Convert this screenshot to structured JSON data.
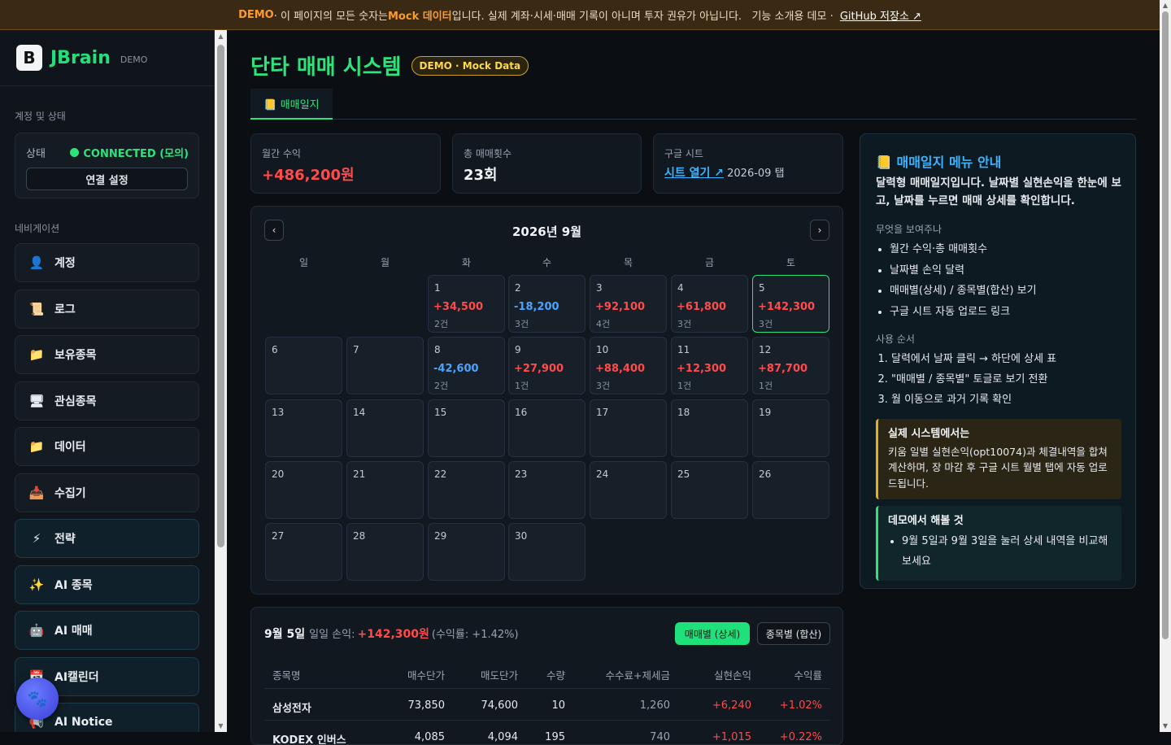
{
  "banner": {
    "demo": "DEMO",
    "pre": " · 이 페이지의 모든 숫자는 ",
    "mock": "Mock 데이터",
    "post": "입니다. 실제 계좌·시세·매매 기록이 아니며 투자 권유가 아닙니다.   기능 소개용 데모 · ",
    "link": "GitHub 저장소 ↗"
  },
  "sidebar": {
    "brand": {
      "logo": "B",
      "name": "JBrain",
      "tag": "DEMO"
    },
    "account_section": "계정 및 상태",
    "status_label": "상태",
    "status_value": "CONNECTED (모의)",
    "connect_button": "연결 설정",
    "nav_section": "네비게이션",
    "items": [
      {
        "label": "계정",
        "icon": "👤"
      },
      {
        "label": "로그",
        "icon": "📜"
      },
      {
        "label": "보유종목",
        "icon": "📁"
      },
      {
        "label": "관심종목",
        "icon": "🖥"
      },
      {
        "label": "데이터",
        "icon": "📁"
      },
      {
        "label": "수집기",
        "icon": "📥"
      },
      {
        "label": "전략",
        "icon": "⚡"
      },
      {
        "label": "AI 종목",
        "icon": "✨"
      },
      {
        "label": "AI 매매",
        "icon": "🤖"
      },
      {
        "label": "AI캘린더",
        "icon": "📅"
      },
      {
        "label": "AI Notice",
        "icon": "📢"
      }
    ],
    "fab_icon": "🐾"
  },
  "header": {
    "title": "단타 매매 시스템",
    "badge": "DEMO · Mock Data",
    "tab": "📒 매매일지"
  },
  "kpis": {
    "month_label": "월간 수익",
    "month_value": "+486,200원",
    "count_label": "총 매매횟수",
    "count_value": "23회",
    "sheet_label": "구글 시트",
    "sheet_link": "시트 열기 ↗",
    "sheet_tab": " 2026-09 탭"
  },
  "calendar": {
    "title": "2026년 9월",
    "prev": "‹",
    "next": "›",
    "weekdays": [
      "일",
      "월",
      "화",
      "수",
      "목",
      "금",
      "토"
    ],
    "selected_day": 5,
    "days": [
      {
        "d": "1",
        "pnl": "+34,500",
        "cnt": "2건",
        "sign": "pos"
      },
      {
        "d": "2",
        "pnl": "-18,200",
        "cnt": "3건",
        "sign": "neg"
      },
      {
        "d": "3",
        "pnl": "+92,100",
        "cnt": "4건",
        "sign": "pos"
      },
      {
        "d": "4",
        "pnl": "+61,800",
        "cnt": "3건",
        "sign": "pos"
      },
      {
        "d": "5",
        "pnl": "+142,300",
        "cnt": "3건",
        "sign": "pos"
      },
      {
        "d": "6"
      },
      {
        "d": "7"
      },
      {
        "d": "8",
        "pnl": "-42,600",
        "cnt": "2건",
        "sign": "neg"
      },
      {
        "d": "9",
        "pnl": "+27,900",
        "cnt": "1건",
        "sign": "pos"
      },
      {
        "d": "10",
        "pnl": "+88,400",
        "cnt": "3건",
        "sign": "pos"
      },
      {
        "d": "11",
        "pnl": "+12,300",
        "cnt": "1건",
        "sign": "pos"
      },
      {
        "d": "12",
        "pnl": "+87,700",
        "cnt": "1건",
        "sign": "pos"
      },
      {
        "d": "13"
      },
      {
        "d": "14"
      },
      {
        "d": "15"
      },
      {
        "d": "16"
      },
      {
        "d": "17"
      },
      {
        "d": "18"
      },
      {
        "d": "19"
      },
      {
        "d": "20"
      },
      {
        "d": "21"
      },
      {
        "d": "22"
      },
      {
        "d": "23"
      },
      {
        "d": "24"
      },
      {
        "d": "25"
      },
      {
        "d": "26"
      },
      {
        "d": "27"
      },
      {
        "d": "28"
      },
      {
        "d": "29"
      },
      {
        "d": "30"
      }
    ]
  },
  "detail": {
    "date": "9월 5일",
    "label": "일일 손익:",
    "amount": "+142,300원",
    "rate": "(수익률: +1.42%)",
    "toggle_on": "매매별 (상세)",
    "toggle_off": "종목별 (합산)",
    "columns": [
      "종목명",
      "매수단가",
      "매도단가",
      "수량",
      "수수료+제세금",
      "실현손익",
      "수익률"
    ],
    "rows": [
      [
        "삼성전자",
        "73,850",
        "74,600",
        "10",
        "1,260",
        "+6,240",
        "+1.02%"
      ],
      [
        "KODEX 인버스",
        "4,085",
        "4,094",
        "195",
        "740",
        "+1,015",
        "+0.22%"
      ]
    ]
  },
  "guide": {
    "title": "📒 매매일지 메뉴 안내",
    "intro": "달력형 매매일지입니다. 날짜별 실현손익을 한눈에 보고, 날짜를 누르면 매매 상세를 확인합니다.",
    "what_title": "무엇을 보여주나",
    "what": [
      "월간 수익·총 매매횟수",
      "날짜별 손익 달력",
      "매매별(상세) / 종목별(합산) 보기",
      "구글 시트 자동 업로드 링크"
    ],
    "how_title": "사용 순서",
    "how": [
      "달력에서 날짜 클릭 → 하단에 상세 표",
      "\"매매별 / 종목별\" 토글로 보기 전환",
      "월 이동으로 과거 기록 확인"
    ],
    "real_title": "실제 시스템에서는",
    "real_text": "키움 일별 실현손익(opt10074)과 체결내역을 합쳐 계산하며, 장 마감 후 구글 시트 월별 탭에 자동 업로드됩니다.",
    "demo_title": "데모에서 해볼 것",
    "demo_item": "9월 5일과 9월 3일을 눌러 상세 내역을 비교해 보세요"
  },
  "colors": {
    "accent_green": "#2ee27e",
    "profit_red": "#ff4b4b",
    "loss_blue": "#4aa3ff",
    "info_blue": "#3ab4ff"
  }
}
